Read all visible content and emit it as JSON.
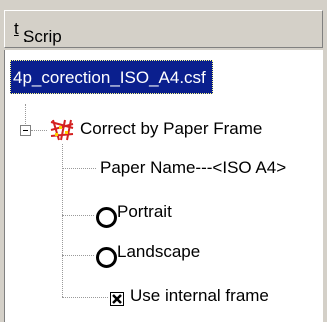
{
  "header": {
    "label_before": "Scrip",
    "label_mnemonic": "t",
    "label_after": ":"
  },
  "tree": {
    "file_name": "4p_corection_ISO_A4.csf",
    "root_node": {
      "label": "Correct by Paper Frame",
      "expanded": true,
      "icon": "paper-frame-icon"
    },
    "children": [
      {
        "label": "Paper Name---<ISO A4>"
      },
      {
        "label": "Portrait",
        "type": "radio",
        "checked": false
      },
      {
        "label": "Landscape",
        "type": "radio",
        "checked": false
      },
      {
        "label": "Use internal frame",
        "type": "checkbox",
        "checked": true
      }
    ]
  },
  "colors": {
    "selection_bg": "#0a1f8e",
    "panel_bg": "#ffffff",
    "chrome_bg": "#d4d0c8",
    "icon_red": "#d42020"
  }
}
